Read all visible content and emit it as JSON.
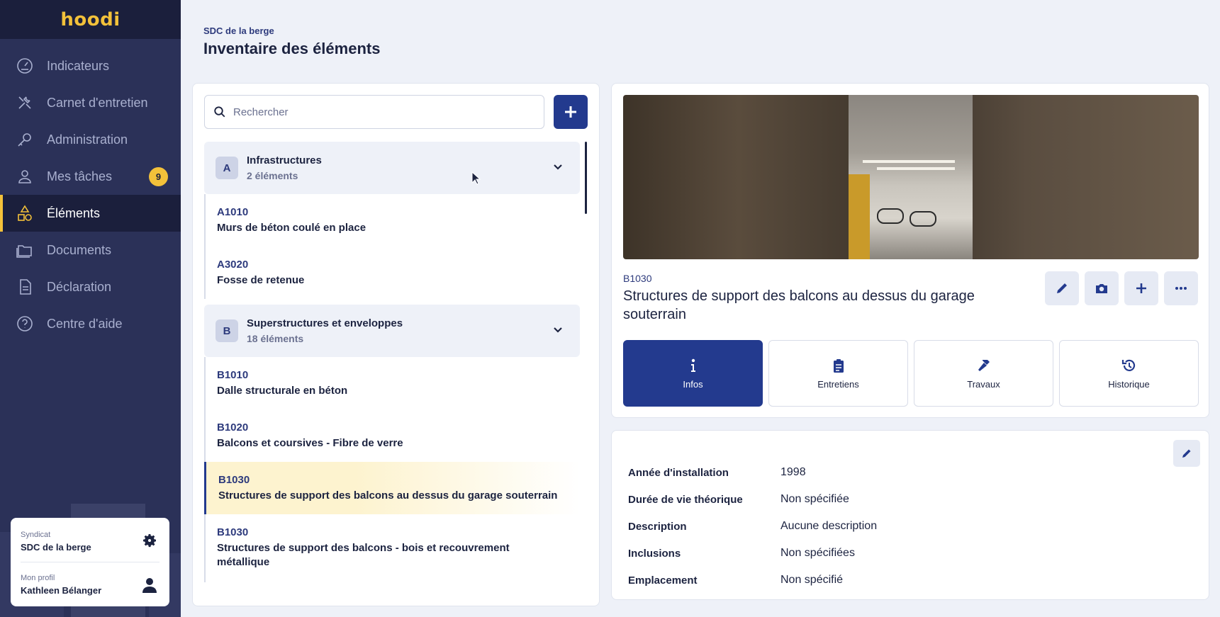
{
  "app": {
    "logo": "hoodi"
  },
  "sidebar": {
    "items": [
      {
        "label": "Indicateurs",
        "icon": "gauge-icon"
      },
      {
        "label": "Carnet d'entretien",
        "icon": "tools-icon"
      },
      {
        "label": "Administration",
        "icon": "key-icon"
      },
      {
        "label": "Mes tâches",
        "icon": "user-icon",
        "badge": "9"
      },
      {
        "label": "Éléments",
        "icon": "shapes-icon",
        "active": true
      },
      {
        "label": "Documents",
        "icon": "folder-icon"
      },
      {
        "label": "Déclaration",
        "icon": "document-icon"
      },
      {
        "label": "Centre d'aide",
        "icon": "help-icon"
      }
    ],
    "profile": {
      "syndicat_label": "Syndicat",
      "syndicat_value": "SDC de la berge",
      "profile_label": "Mon profil",
      "profile_value": "Kathleen Bélanger"
    }
  },
  "header": {
    "breadcrumb": "SDC de la berge",
    "title": "Inventaire des éléments"
  },
  "search": {
    "placeholder": "Rechercher"
  },
  "groups": [
    {
      "letter": "A",
      "title": "Infrastructures",
      "count": "2 éléments",
      "items": [
        {
          "code": "A1010",
          "name": "Murs de béton coulé en place"
        },
        {
          "code": "A3020",
          "name": "Fosse de retenue"
        }
      ]
    },
    {
      "letter": "B",
      "title": "Superstructures et enveloppes",
      "count": "18 éléments",
      "items": [
        {
          "code": "B1010",
          "name": "Dalle structurale en béton"
        },
        {
          "code": "B1020",
          "name": "Balcons et coursives - Fibre de verre"
        },
        {
          "code": "B1030",
          "name": "Structures de support des balcons au dessus du garage souterrain",
          "selected": true
        },
        {
          "code": "B1030",
          "name": "Structures de support des balcons - bois et recouvrement métallique"
        }
      ]
    }
  ],
  "detail": {
    "code": "B1030",
    "title": "Structures de support des balcons au dessus du garage souterrain",
    "actions": [
      "pencil-icon",
      "camera-icon",
      "plus-icon",
      "more-icon"
    ],
    "tabs": [
      {
        "label": "Infos",
        "icon": "info-icon",
        "active": true
      },
      {
        "label": "Entretiens",
        "icon": "clipboard-icon"
      },
      {
        "label": "Travaux",
        "icon": "hammer-icon"
      },
      {
        "label": "Historique",
        "icon": "history-icon"
      }
    ]
  },
  "info": {
    "rows": [
      {
        "label": "Année d'installation",
        "value": "1998"
      },
      {
        "label": "Durée de vie théorique",
        "value": "Non spécifiée"
      },
      {
        "label": "Description",
        "value": "Aucune description"
      },
      {
        "label": "Inclusions",
        "value": "Non spécifiées"
      },
      {
        "label": "Emplacement",
        "value": "Non spécifié"
      }
    ]
  },
  "colors": {
    "brand": "#2b3158",
    "accent": "#f3c13a",
    "primary": "#233a8e"
  }
}
